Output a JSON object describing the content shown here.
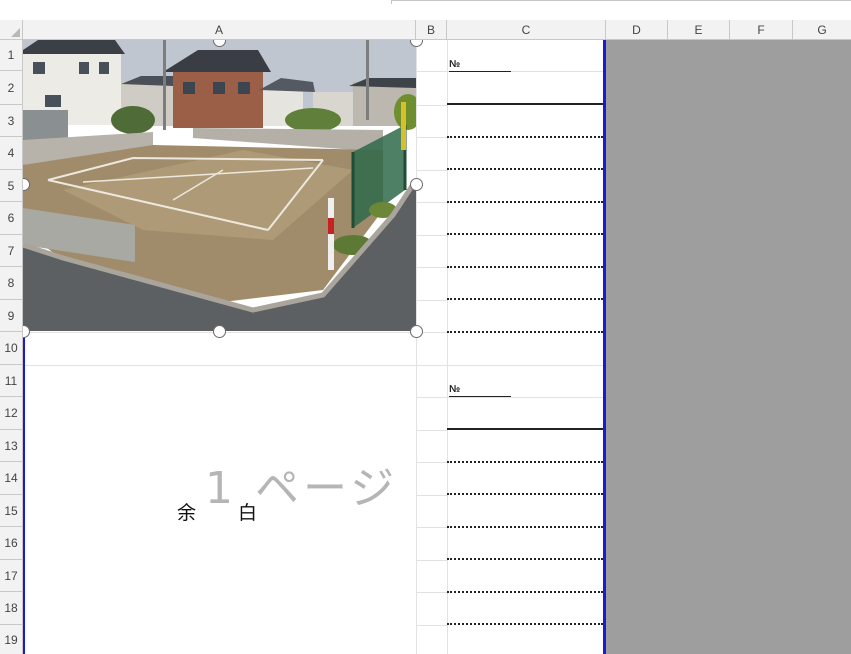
{
  "columns": [
    "A",
    "B",
    "C",
    "D",
    "E",
    "F",
    "G"
  ],
  "rows": [
    "1",
    "2",
    "3",
    "4",
    "5",
    "6",
    "7",
    "8",
    "9",
    "10",
    "11",
    "12",
    "13",
    "14",
    "15",
    "16",
    "17",
    "18",
    "19"
  ],
  "sheet": {
    "block1_no_label": "№",
    "block2_no_label": "№",
    "yohaku_left": "余",
    "yohaku_right": "白",
    "page_watermark": "1 ページ"
  },
  "picture": {
    "subject": "vacant residential lot with houses and green fence"
  }
}
